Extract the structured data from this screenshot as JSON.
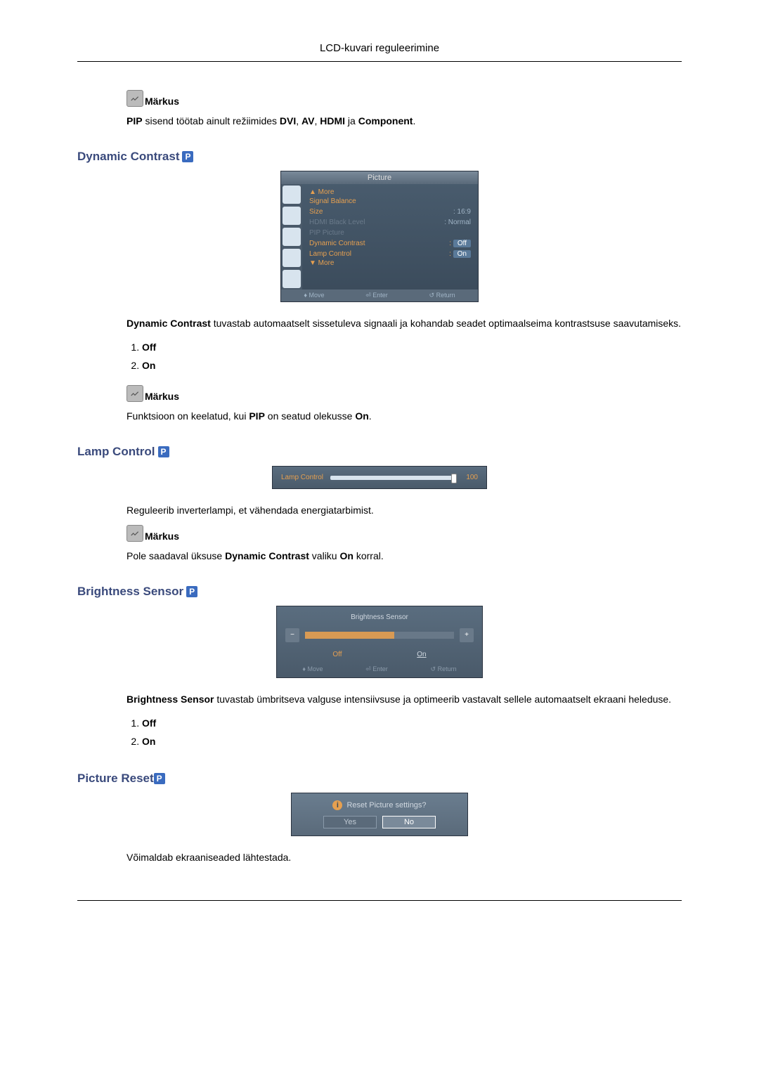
{
  "header": {
    "title": "LCD-kuvari reguleerimine"
  },
  "notes": {
    "label": "Märkus",
    "pip_note_pre": "PIP",
    "pip_note_mid": " sisend töötab ainult režiimides ",
    "pip_note_b1": "DVI",
    "pip_sep": ", ",
    "pip_note_b2": "AV",
    "pip_note_b3": "HDMI",
    "pip_and": " ja ",
    "pip_note_b4": "Component",
    "period": "."
  },
  "dynamic_contrast": {
    "heading": "Dynamic Contrast",
    "desc_b": "Dynamic Contrast",
    "desc_rest": " tuvastab automaatselt sissetuleva signaali ja kohandab seadet optimaalseima kontrastsuse saavutamiseks.",
    "options": {
      "off": "Off",
      "on": "On"
    },
    "note_pre": "Funktsioon on keelatud, kui ",
    "note_b1": "PIP",
    "note_mid": " on seatud olekusse ",
    "note_b2": "On"
  },
  "osd1": {
    "title": "Picture",
    "more_up": "▲ More",
    "items": [
      {
        "label": "Signal Balance",
        "value": ""
      },
      {
        "label": "Size",
        "value": "16:9"
      },
      {
        "label": "HDMI Black Level",
        "value": "Normal",
        "dim": true
      },
      {
        "label": "PIP Picture",
        "value": "",
        "dim": true
      },
      {
        "label": "Dynamic Contrast",
        "value": "Off",
        "orange": true,
        "hl": true
      },
      {
        "label": "Lamp Control",
        "value": "On",
        "orange": true,
        "hl": true
      }
    ],
    "more_down": "▼ More",
    "footer": {
      "move": "Move",
      "enter": "Enter",
      "return": "Return"
    }
  },
  "lamp_control": {
    "heading": "Lamp Control",
    "osd_label": "Lamp Control",
    "osd_value": "100",
    "desc": "Reguleerib inverterlampi, et vähendada energiatarbimist.",
    "note_pre": "Pole saadaval üksuse ",
    "note_b1": "Dynamic Contrast",
    "note_mid": " valiku ",
    "note_b2": "On",
    "note_end": " korral."
  },
  "brightness_sensor": {
    "heading": "Brightness Sensor",
    "osd_title": "Brightness Sensor",
    "minus": "−",
    "plus": "+",
    "off": "Off",
    "on": "On",
    "footer": {
      "move": "Move",
      "enter": "Enter",
      "return": "Return"
    },
    "desc_b": "Brightness Sensor",
    "desc_rest": " tuvastab ümbritseva valguse intensiivsuse ja optimeerib vastavalt sellele automaatselt ekraani heleduse.",
    "options": {
      "off": "Off",
      "on": "On"
    }
  },
  "picture_reset": {
    "heading": "Picture Reset",
    "msg": "Reset Picture settings?",
    "yes": "Yes",
    "no": "No",
    "desc": "Võimaldab ekraaniseaded lähtestada."
  }
}
